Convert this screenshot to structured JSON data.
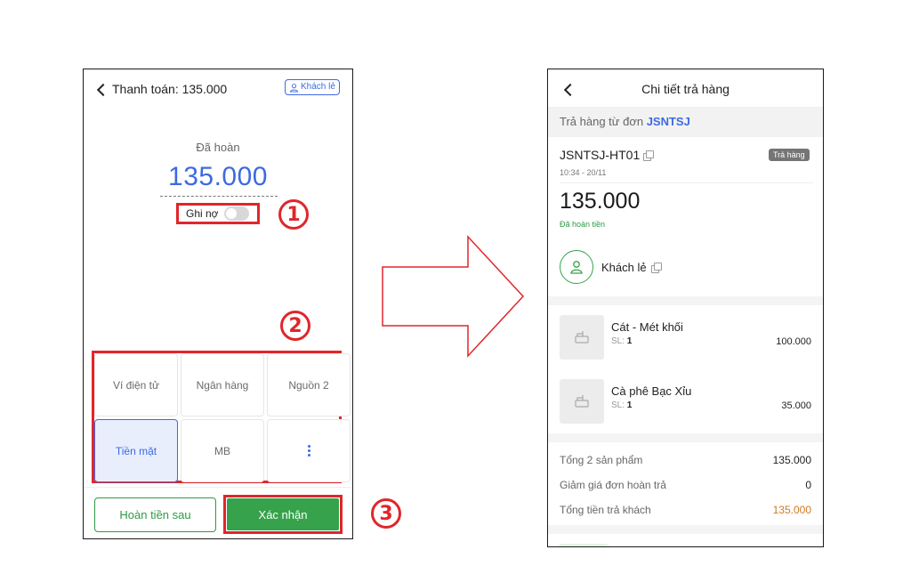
{
  "left_screen": {
    "title": "Thanh toán: 135.000",
    "customer_badge": "Khách lẻ",
    "refunded_label": "Đã hoàn",
    "amount": "135.000",
    "debt_toggle_label": "Ghi nợ",
    "debt_toggle_on": false,
    "payment_methods": [
      {
        "label": "Ví điện tử",
        "selected": false
      },
      {
        "label": "Ngân hàng",
        "selected": false
      },
      {
        "label": "Nguồn 2",
        "selected": false
      },
      {
        "label": "Tiền mặt",
        "selected": true
      },
      {
        "label": "MB",
        "selected": false
      },
      {
        "label": "more-vertical-icon",
        "selected": false
      }
    ],
    "refund_later_button": "Hoàn tiền sau",
    "confirm_button": "Xác nhận"
  },
  "step_markers": [
    "1",
    "2",
    "3"
  ],
  "right_screen": {
    "title": "Chi tiết trả hàng",
    "source_prefix": "Trả hàng từ đơn",
    "source_code": "JSNTSJ",
    "doc_code": "JSNTSJ-HT01",
    "doc_type_badge": "Trả hàng",
    "doc_time": "10:34 - 20/11",
    "amount": "135.000",
    "status": "Đã hoàn tiền",
    "customer_name": "Khách lẻ",
    "products": [
      {
        "name": "Cát - Mét khối",
        "qty_label": "SL:",
        "qty": "1",
        "price": "100.000"
      },
      {
        "name": "Cà phê Bạc Xỉu",
        "qty_label": "SL:",
        "qty": "1",
        "price": "35.000"
      }
    ],
    "summary": [
      {
        "label": "Tổng 2 sản phẩm",
        "value": "135.000"
      },
      {
        "label": "Giảm giá đơn hoàn trả",
        "value": "0"
      },
      {
        "label": "Tổng tiền trả khách",
        "value": "135.000"
      }
    ]
  },
  "colors": {
    "accent_blue": "#3d6ae0",
    "green": "#36a24c",
    "annotation_red": "#e0262b",
    "orange": "#d17a1e"
  }
}
